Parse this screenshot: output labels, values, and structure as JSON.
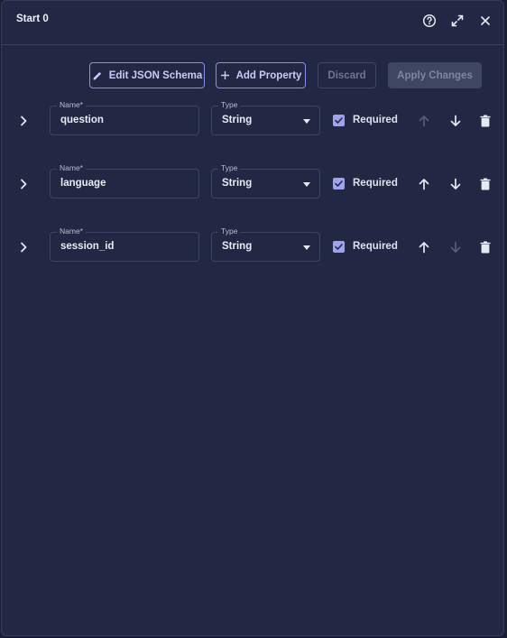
{
  "dialog": {
    "title": "Start 0"
  },
  "toolbar": {
    "edit_json_label": "Edit JSON Schema",
    "add_property_label": "Add Property",
    "discard_label": "Discard",
    "apply_label": "Apply Changes"
  },
  "properties": [
    {
      "name_label": "Name*",
      "name": "question",
      "type_label": "Type",
      "type": "String",
      "required_label": "Required",
      "required": true,
      "up_enabled": false,
      "down_enabled": true
    },
    {
      "name_label": "Name*",
      "name": "language",
      "type_label": "Type",
      "type": "String",
      "required_label": "Required",
      "required": true,
      "up_enabled": true,
      "down_enabled": true
    },
    {
      "name_label": "Name*",
      "name": "session_id",
      "type_label": "Type",
      "type": "String",
      "required_label": "Required",
      "required": true,
      "up_enabled": true,
      "down_enabled": false
    }
  ],
  "colors": {
    "panel_bg": "#222843",
    "accent": "#8b8ff0",
    "checkbox": "#9ea2f0",
    "disabled_icon": "#555c7c"
  },
  "icons": [
    "help-circle-icon",
    "expand-icon",
    "close-icon",
    "pencil-icon",
    "plus-icon",
    "chevron-right-icon",
    "caret-down-icon",
    "checkbox-checked-icon",
    "arrow-up-icon",
    "arrow-down-icon",
    "trash-icon"
  ]
}
